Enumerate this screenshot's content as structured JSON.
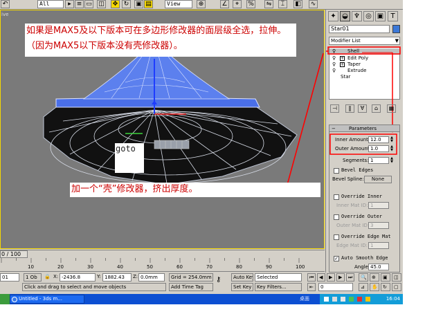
{
  "toolbar": {
    "selection_filter": "All",
    "coord_system": "View",
    "icons": [
      "undo-icon",
      "select-icon",
      "select-region-icon",
      "window-crossing-icon",
      "select-move-icon",
      "select-rotate-icon",
      "select-scale-icon",
      "reference-coord-dropdown",
      "pivot-icon",
      "snap-icon",
      "angle-snap-icon",
      "mirror-icon",
      "align-icon"
    ]
  },
  "viewport": {
    "label": "ive",
    "note_top": "如果是MAX5及以下版本可在多边形修改器的面层级全选，拉伸。（因为MAX5以下版本没有壳修改器）。",
    "note_mid": "加一个“壳”修改器，挤出厚度。",
    "goto_label": "goto"
  },
  "command_panel": {
    "object_name": "Star01",
    "object_color": "#3b78d8",
    "modifier_list_label": "Modifier List",
    "stack": [
      {
        "label": "Shell",
        "bulb": true,
        "plus": false,
        "selected": true
      },
      {
        "label": "Edit Poly",
        "bulb": true,
        "plus": true,
        "selected": false
      },
      {
        "label": "Taper",
        "bulb": true,
        "plus": true,
        "selected": false
      },
      {
        "label": "Extrude",
        "bulb": true,
        "plus": false,
        "selected": false
      },
      {
        "label": "Star",
        "bulb": false,
        "plus": false,
        "selected": false
      }
    ],
    "parameters": {
      "title": "Parameters",
      "inner_amount_label": "Inner Amount:",
      "inner_amount_value": "12.0",
      "outer_amount_label": "Outer Amount:",
      "outer_amount_value": "1.0",
      "segments_label": "Segments:",
      "segments_value": "1",
      "bevel_edges_label": "Bevel Edges",
      "bevel_spline_label": "Bevel Spline:",
      "bevel_spline_button": "None",
      "override_inner_label": "Override Inner",
      "inner_mat_id_label": "Inner Mat ID:",
      "inner_mat_id_value": "1",
      "override_outer_label": "Override Outer",
      "outer_mat_id_label": "Outer Mat ID:",
      "outer_mat_id_value": "3",
      "override_edge_label": "Override Edge Mat",
      "edge_mat_id_label": "Edge Mat ID:",
      "edge_mat_id_value": "1",
      "auto_smooth_label": "Auto Smooth Edge",
      "auto_smooth_checked": true,
      "angle_label": "Angle:",
      "angle_value": "45.0"
    }
  },
  "timeline": {
    "frame_label": "0 / 100",
    "ticks": [
      "10",
      "20",
      "30",
      "40",
      "50",
      "60",
      "70",
      "80",
      "90",
      "100"
    ]
  },
  "status": {
    "selection_count": "1 Ob",
    "x_label": "X:",
    "x_value": "-2436.8",
    "y_label": "Y:",
    "y_value": "1882.43",
    "z_label": "Z:",
    "z_value": "0.0mm",
    "grid": "Grid = 254.0mm",
    "prompt": "Click and drag to select and move objects",
    "add_time_tag": "Add Time Tag",
    "auto_key": "Auto Key",
    "set_key": "Set Key",
    "key_mode": "Selected",
    "key_filters": "Key Filters...",
    "frame": "0",
    "left_field": "01"
  },
  "taskbar": {
    "task_label": "Untitled - 3ds m...",
    "desktop_label": "桌面",
    "clock": "16:04"
  },
  "colors": {
    "annotation_red": "#cc0000",
    "arrow_red": "#ff0000",
    "mesh_blue": "#4a6fe8",
    "viewport_bg": "#7a7a7a"
  }
}
